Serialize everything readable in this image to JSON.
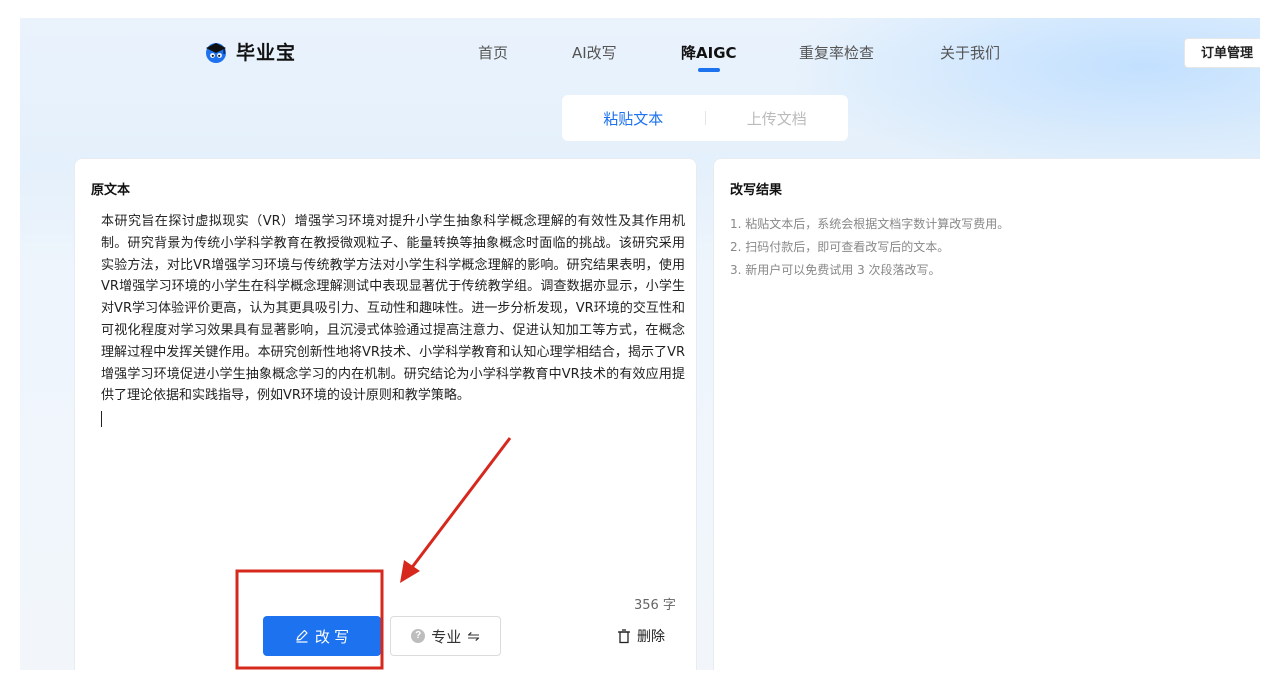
{
  "brand": {
    "name": "毕业宝"
  },
  "nav": {
    "items": [
      "首页",
      "AI改写",
      "降AIGC",
      "重复率检查",
      "关于我们"
    ],
    "active_index": 2
  },
  "header": {
    "order_label": "订单管理"
  },
  "mode_tabs": {
    "paste": "粘贴文本",
    "upload": "上传文档",
    "active": "paste"
  },
  "left_panel": {
    "title": "原文本",
    "text": "本研究旨在探讨虚拟现实（VR）增强学习环境对提升小学生抽象科学概念理解的有效性及其作用机制。研究背景为传统小学科学教育在教授微观粒子、能量转换等抽象概念时面临的挑战。该研究采用实验方法，对比VR增强学习环境与传统教学方法对小学生科学概念理解的影响。研究结果表明，使用VR增强学习环境的小学生在科学概念理解测试中表现显著优于传统教学组。调查数据亦显示，小学生对VR学习体验评价更高，认为其更具吸引力、互动性和趣味性。进一步分析发现，VR环境的交互性和可视化程度对学习效果具有显著影响，且沉浸式体验通过提高注意力、促进认知加工等方式，在概念理解过程中发挥关键作用。本研究创新性地将VR技术、小学科学教育和认知心理学相结合，揭示了VR增强学习环境促进小学生抽象概念学习的内在机制。研究结论为小学科学教育中VR技术的有效应用提供了理论依据和实践指导，例如VR环境的设计原则和教学策略。",
    "char_count": "356",
    "char_unit": "字",
    "rewrite_label": "改 写",
    "mode_label": "专业",
    "delete_label": "删除"
  },
  "right_panel": {
    "title": "改写结果",
    "hints": [
      "1. 粘贴文本后，系统会根据文档字数计算改写费用。",
      "2. 扫码付款后，即可查看改写后的文本。",
      "3. 新用户可以免费试用 3 次段落改写。"
    ]
  },
  "colors": {
    "accent": "#1c72ef",
    "annotation": "#d6281c"
  }
}
